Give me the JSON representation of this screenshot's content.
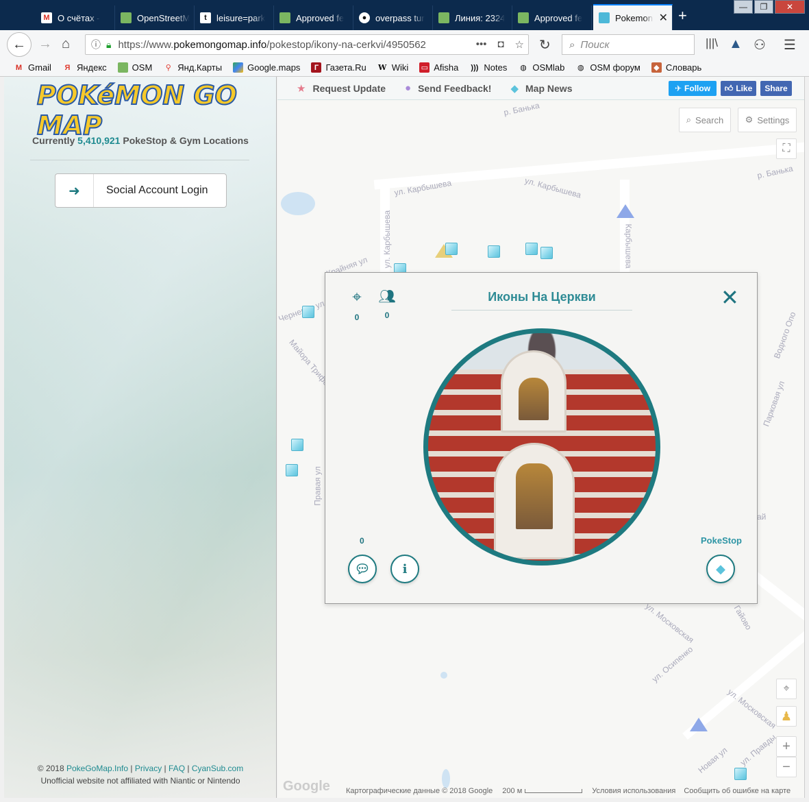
{
  "browser": {
    "tabs": [
      {
        "label": "О счётах - "
      },
      {
        "label": "OpenStreetM"
      },
      {
        "label": "leisure=park"
      },
      {
        "label": "Approved fe"
      },
      {
        "label": "overpass tur"
      },
      {
        "label": "Линия: 2324"
      },
      {
        "label": "Approved fe"
      },
      {
        "label": "Pokemon"
      }
    ],
    "url_prefix": "https://www.",
    "url_domain": "pokemongomap.info",
    "url_path": "/pokestop/ikony-na-cerkvi/4950562",
    "search_placeholder": "Поиск",
    "bookmarks": [
      {
        "label": "Gmail"
      },
      {
        "label": "Яндекс"
      },
      {
        "label": "OSM"
      },
      {
        "label": "Янд.Карты"
      },
      {
        "label": "Google.maps"
      },
      {
        "label": "Газета.Ru"
      },
      {
        "label": "Wiki"
      },
      {
        "label": "Afisha"
      },
      {
        "label": "Notes"
      },
      {
        "label": "OSMlab"
      },
      {
        "label": "OSM форум"
      },
      {
        "label": "Словарь"
      }
    ]
  },
  "sidebar": {
    "logo_text": "POKéMON GO MAP",
    "stat_prefix": "Currently",
    "stat_count": "5,410,921",
    "stat_suffix": "PokeStop & Gym Locations",
    "login_label": "Social Account Login",
    "footer": {
      "copyright": "© 2018",
      "site": "PokeGoMap.Info",
      "privacy": "Privacy",
      "faq": "FAQ",
      "cyansub": "CyanSub.com",
      "sep": "|",
      "disclaimer": "Unofficial website not affiliated with Niantic or Nintendo"
    }
  },
  "map": {
    "topbar": {
      "request_update": "Request Update",
      "send_feedback": "Send Feedback!",
      "map_news": "Map News",
      "follow": "Follow",
      "like": "Like",
      "share": "Share"
    },
    "search_label": "Search",
    "settings_label": "Settings",
    "streets": {
      "banka_1": "р. Банька",
      "banka_2": "р. Банька",
      "karbysheva_1": "ул. Карбышева",
      "karbysheva_2": "ул. Карбышева",
      "karbysheva_3": "ул. Карбышева",
      "karbysheva_4": "Карбышева",
      "krainyaya": "Крайняя ул",
      "chernevaya": "Черневая ул",
      "trifonova": "Майора Трифонова",
      "pravaya": "Правая ул",
      "moskovskaya": "ул. Московская",
      "moskovskaya2": "ул. Московская",
      "osipenko": "ул. Осипенко",
      "novaya": "Новая ул",
      "pravdy": "ул. Правды",
      "parkovaya": "Парковая ул",
      "bodnogo": "Водного Опо",
      "gaiyovo": "Гайово",
      "ai": "ай"
    },
    "footer": {
      "google": "Google",
      "data": "Картографические данные © 2018 Google",
      "scale": "200 м",
      "terms": "Условия использования",
      "report": "Сообщить об ошибке на карте"
    }
  },
  "popup": {
    "title": "Иконы На Церкви",
    "checkins": "0",
    "users": "0",
    "comments": "0",
    "type": "PokeStop"
  },
  "colors": {
    "accent": "#1e7a80",
    "title": "#2e8b95",
    "tabbar": "#0c2a4d",
    "twitter": "#1da1f2",
    "facebook": "#4267b2"
  }
}
